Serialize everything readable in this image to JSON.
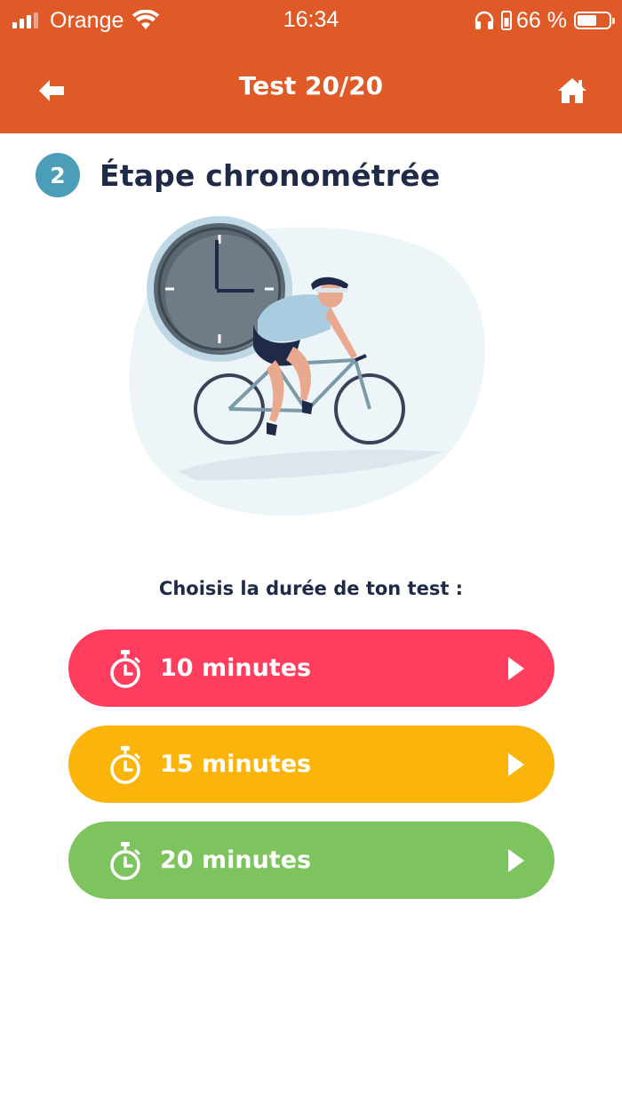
{
  "status_bar": {
    "carrier": "Orange",
    "time": "16:34",
    "battery_percent": "66 %",
    "battery_level": 0.66,
    "icons": [
      "signal-icon",
      "wifi-icon",
      "headphones-icon",
      "battery-icon"
    ]
  },
  "header": {
    "title": "Test 20/20",
    "background_color": "#E05A28",
    "back_icon": "arrow-left-icon",
    "home_icon": "home-icon"
  },
  "step": {
    "number": "2",
    "title": "Étape chronométrée",
    "badge_color": "#4C9DB8"
  },
  "illustration": {
    "description_icon": "cyclist-with-clock-illustration"
  },
  "prompt": "Choisis la durée de ton test :",
  "options": [
    {
      "label": "10 minutes",
      "color": "#FF3E5F",
      "icon": "stopwatch-icon",
      "arrow_icon": "play-arrow-icon"
    },
    {
      "label": "15 minutes",
      "color": "#FBB40A",
      "icon": "stopwatch-icon",
      "arrow_icon": "play-arrow-icon"
    },
    {
      "label": "20 minutes",
      "color": "#7DC35E",
      "icon": "stopwatch-icon",
      "arrow_icon": "play-arrow-icon"
    }
  ]
}
